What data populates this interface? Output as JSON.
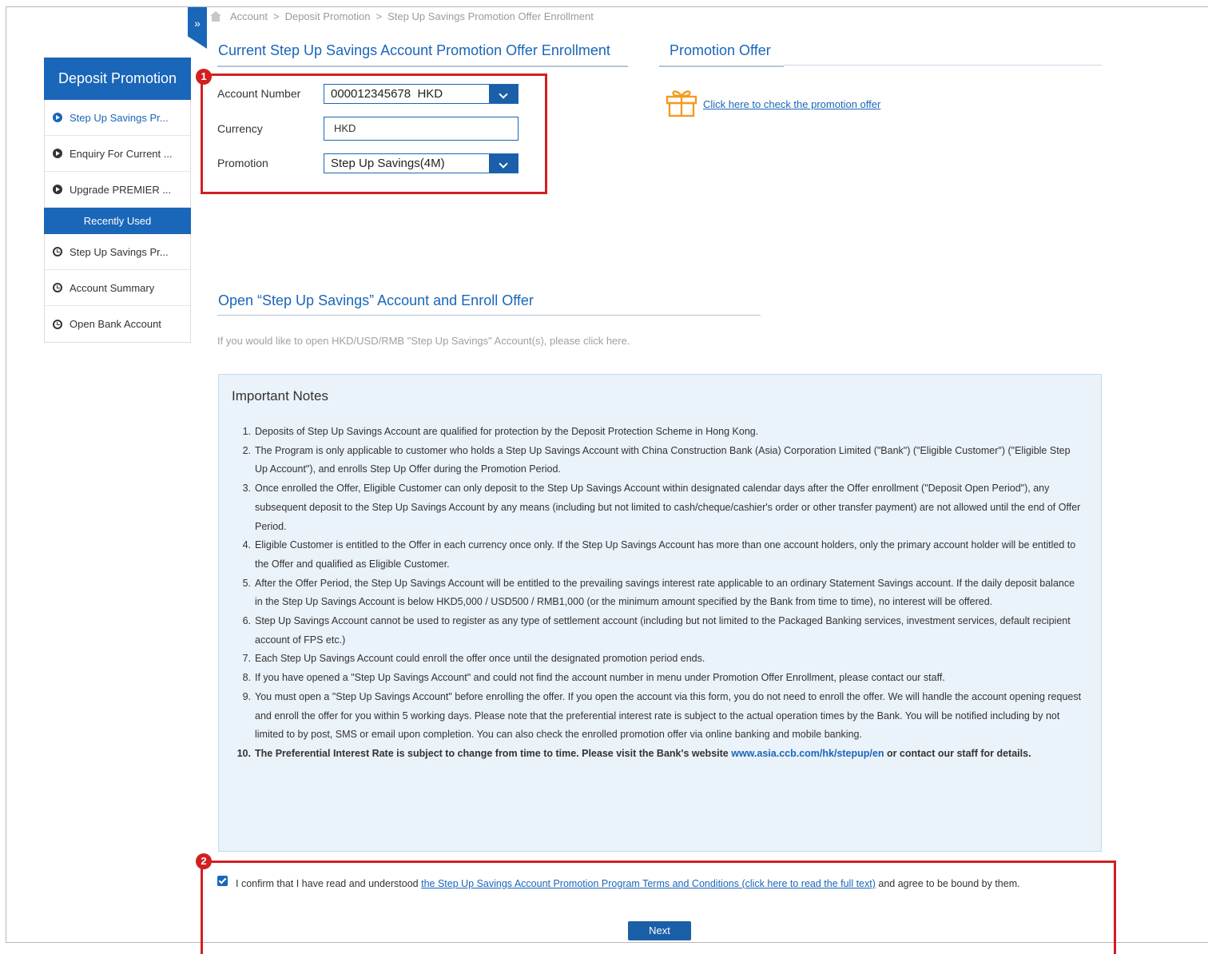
{
  "breadcrumb": [
    "Account",
    "Deposit Promotion",
    "Step Up Savings Promotion Offer Enrollment"
  ],
  "sidebar": {
    "title": "Deposit Promotion",
    "items": [
      {
        "label": "Step Up Savings Pr...",
        "active": true
      },
      {
        "label": "Enquiry For Current ...",
        "active": false
      },
      {
        "label": "Upgrade PREMIER ...",
        "active": false
      }
    ],
    "recent_title": "Recently Used",
    "recent": [
      {
        "label": "Step Up Savings Pr..."
      },
      {
        "label": "Account Summary"
      },
      {
        "label": "Open Bank Account"
      }
    ]
  },
  "enrollment": {
    "title": "Current Step Up Savings Account Promotion Offer Enrollment",
    "account_label": "Account Number",
    "account_value": "000012345678  HKD",
    "currency_label": "Currency",
    "currency_value": "HKD",
    "promotion_label": "Promotion",
    "promotion_value": "Step Up Savings(4M)"
  },
  "promotion_offer": {
    "title": "Promotion Offer",
    "link": "Click here to check the promotion offer"
  },
  "open_account": {
    "title": "Open “Step Up Savings” Account and Enroll Offer",
    "desc": "If you would like to open HKD/USD/RMB \"Step Up Savings\" Account(s), please click here."
  },
  "notes": {
    "title": "Important Notes",
    "items": [
      "Deposits of Step Up Savings Account are qualified for protection by the Deposit Protection Scheme in Hong Kong.",
      "The Program is only applicable to customer who holds a Step Up Savings Account with China Construction Bank (Asia) Corporation Limited (\"Bank\") (\"Eligible Customer\") (\"Eligible Step Up Account\"), and enrolls Step Up Offer during the Promotion Period.",
      "Once enrolled the Offer, Eligible Customer can only deposit to the Step Up Savings Account within designated calendar days after the Offer enrollment (\"Deposit Open Period\"), any subsequent deposit to the Step Up Savings Account by any means (including but not limited to cash/cheque/cashier's order or other transfer payment) are not allowed until the end of Offer Period.",
      "Eligible Customer is entitled to the Offer in each currency once only. If the Step Up Savings Account has more than one account holders, only the primary account holder will be entitled to the Offer and qualified as Eligible Customer.",
      "After the Offer Period, the Step Up Savings Account will be entitled to the prevailing savings interest rate applicable to an ordinary Statement Savings account. If the daily deposit balance in the Step Up Savings Account is below HKD5,000 / USD500 / RMB1,000 (or the minimum amount specified by the Bank from time to time), no interest will be offered.",
      "Step Up Savings Account cannot be used to register as any type of settlement account (including but not limited to the Packaged Banking services, investment services, default recipient account of FPS etc.)",
      "Each Step Up Savings Account could enroll the offer once until the designated promotion period ends.",
      "If you have opened a \"Step Up Savings Account\" and could not find the account number in menu under Promotion Offer Enrollment, please contact our staff.",
      "You must open a \"Step Up Savings Account\" before enrolling the offer. If you open the account via this form, you do not need to enroll the offer. We will handle the account opening request and enroll the offer for you within 5 working days. Please note that the preferential interest rate is subject to the actual operation times by the Bank. You will be notified including by not limited to by post, SMS or email upon completion. You can also check the enrolled promotion offer via online banking and mobile banking."
    ],
    "item10_a": "The Preferential Interest Rate is subject to change from time to time. Please visit the Bank's website ",
    "item10_url": "www.asia.ccb.com/hk/stepup/en",
    "item10_b": " or contact our staff for details."
  },
  "confirm": {
    "text_a": "I confirm that I have read and understood ",
    "link": "the Step Up Savings Account Promotion Program Terms and Conditions (click here to read the full text)",
    "text_b": " and agree to be bound by them.",
    "checked": true
  },
  "next_label": "Next",
  "badges": [
    "1",
    "2"
  ],
  "colors": {
    "accent": "#1a66b8",
    "highlight": "#d12020",
    "notes_bg": "#eaf2fa"
  }
}
